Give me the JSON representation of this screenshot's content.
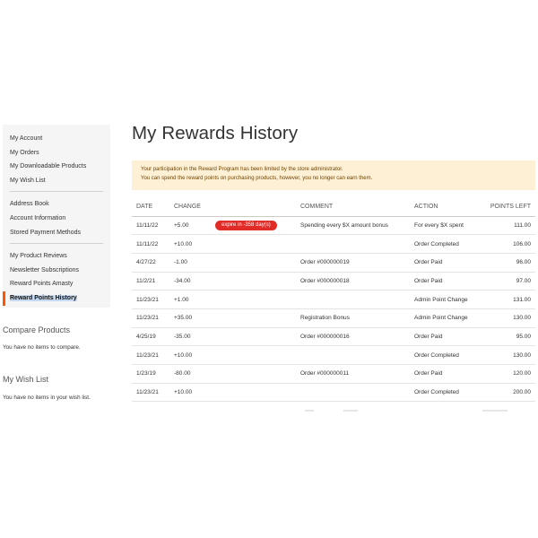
{
  "sidebar": {
    "groups": [
      [
        "My Account",
        "My Orders",
        "My Downloadable Products",
        "My Wish List"
      ],
      [
        "Address Book",
        "Account Information",
        "Stored Payment Methods"
      ],
      [
        "My Product Reviews",
        "Newsletter Subscriptions",
        "Reward Points Amasty"
      ]
    ],
    "active_item": "Reward Points History"
  },
  "compare": {
    "title": "Compare Products",
    "text": "You have no items to compare."
  },
  "wishlist": {
    "title": "My Wish List",
    "text": "You have no items in your wish list."
  },
  "main": {
    "title": "My Rewards History",
    "notice_line1": "Your participation in the Reward Program has been limited by the store administrator.",
    "notice_line2": "You can spend the reward points on purchasing products, however, you no longer can earn them."
  },
  "table": {
    "headers": [
      "DATE",
      "CHANGE",
      "",
      "COMMENT",
      "ACTION",
      "POINTS LEFT"
    ],
    "rows": [
      {
        "date": "11/11/22",
        "change": "+5.00",
        "badge": "expire in -358 day(s)",
        "comment": "Spending every $X amount bonus",
        "action": "For every $X spent",
        "points": "111.00"
      },
      {
        "date": "11/11/22",
        "change": "+10.00",
        "badge": "",
        "comment": "",
        "action": "Order Completed",
        "points": "106.00"
      },
      {
        "date": "4/27/22",
        "change": "-1.00",
        "badge": "",
        "comment": "Order #000000019",
        "action": "Order Paid",
        "points": "96.00"
      },
      {
        "date": "11/2/21",
        "change": "-34.00",
        "badge": "",
        "comment": "Order #000000018",
        "action": "Order Paid",
        "points": "97.00"
      },
      {
        "date": "11/23/21",
        "change": "+1.00",
        "badge": "",
        "comment": "",
        "action": "Admin Point Change",
        "points": "131.00"
      },
      {
        "date": "11/23/21",
        "change": "+35.00",
        "badge": "",
        "comment": "Registration Bonus",
        "action": "Admin Point Change",
        "points": "130.00"
      },
      {
        "date": "4/25/19",
        "change": "-35.00",
        "badge": "",
        "comment": "Order #000000016",
        "action": "Order Paid",
        "points": "95.00"
      },
      {
        "date": "11/23/21",
        "change": "+10.00",
        "badge": "",
        "comment": "",
        "action": "Order Completed",
        "points": "130.00"
      },
      {
        "date": "1/23/19",
        "change": "-80.00",
        "badge": "",
        "comment": "Order #000000011",
        "action": "Order Paid",
        "points": "120.00"
      },
      {
        "date": "11/23/21",
        "change": "+10.00",
        "badge": "",
        "comment": "",
        "action": "Order Completed",
        "points": "200.00"
      }
    ]
  },
  "colors": {
    "accent": "#ff5501",
    "badge": "#e02b27",
    "notice_bg": "#fdf0d5"
  }
}
